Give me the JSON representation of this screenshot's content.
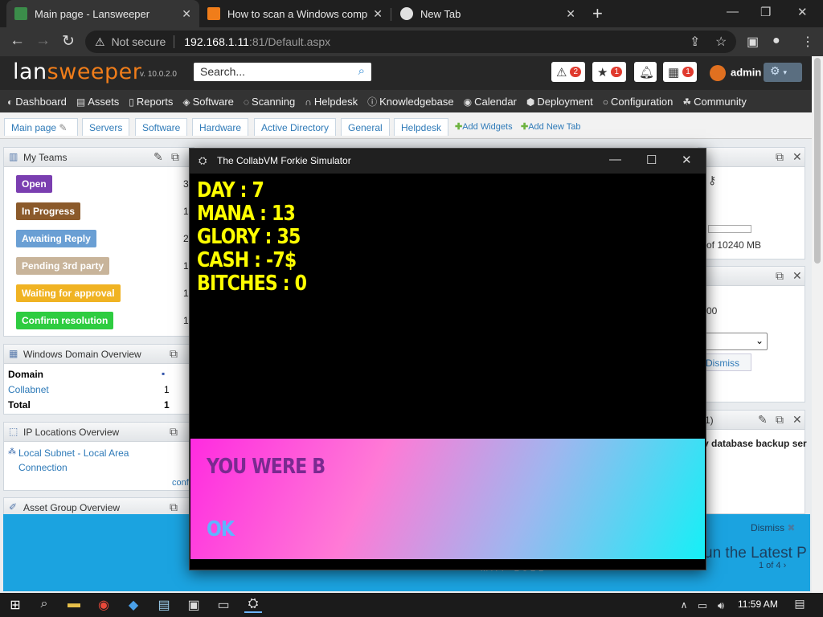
{
  "browser": {
    "tabs": [
      {
        "title": "Main page - Lansweeper"
      },
      {
        "title": "How to scan a Windows compute"
      },
      {
        "title": "New Tab"
      }
    ],
    "new_tab_glyph": "+",
    "omnibox": {
      "security": "Not secure",
      "host": "192.168.1.11",
      "path": ":81/Default.aspx"
    }
  },
  "lansweeper": {
    "logo_part1": "lan",
    "logo_part2": "sweeper",
    "version": "v. 10.0.2.0",
    "search_placeholder": "Search...",
    "badges": {
      "alerts": "2",
      "favorites": "1",
      "calendar": "1"
    },
    "user": "admin",
    "menu": [
      "Dashboard",
      "Assets",
      "Reports",
      "Software",
      "Scanning",
      "Helpdesk",
      "Knowledgebase",
      "Calendar",
      "Deployment",
      "Configuration",
      "Community"
    ],
    "subtabs": [
      "Main page",
      "Servers",
      "Software",
      "Hardware",
      "Active Directory",
      "General",
      "Helpdesk"
    ],
    "add_widgets": "Add Widgets",
    "add_new_tab": "Add New Tab"
  },
  "my_teams": {
    "title": "My Teams",
    "statuses": [
      {
        "label": "Open",
        "count": "3",
        "color": "#7a3eb0"
      },
      {
        "label": "In Progress",
        "count": "1",
        "color": "#8b5a2b"
      },
      {
        "label": "Awaiting Reply",
        "count": "2",
        "color": "#6a9fd4"
      },
      {
        "label": "Pending 3rd party",
        "count": "1",
        "color": "#c8b49a"
      },
      {
        "label": "Waiting for approval",
        "count": "1",
        "color": "#f0b323"
      },
      {
        "label": "Confirm resolution",
        "count": "1",
        "color": "#2ecc40"
      }
    ]
  },
  "domain_overview": {
    "title": "Windows Domain Overview",
    "header": "Domain",
    "rows": [
      {
        "name": "Collabnet",
        "count": "1"
      }
    ],
    "total_label": "Total",
    "total_count": "1"
  },
  "ip_locations": {
    "title": "IP Locations Overview",
    "entry_line1": "Local Subnet - Local Area",
    "entry_line2": "Connection",
    "config_link": "confi"
  },
  "asset_group": {
    "title": "Asset Group Overview"
  },
  "right_panels": {
    "disk_text": "of 10240 MB",
    "value_00": "00",
    "dismiss": "Dismiss",
    "count_1": "1)",
    "backup_text": "v database backup ser",
    "banner_dismiss": "Dismiss",
    "banner_text": "un the Latest P",
    "banner_pager": "1 of 4",
    "banner_date": "MAY 2022"
  },
  "game": {
    "title": "The CollabVM Forkie Simulator",
    "stats": [
      "DAY : 7",
      "MANA : 13",
      "GLORY : 35",
      "CASH : -7$",
      "BITCHES : 0"
    ],
    "message": "YOU WERE B",
    "ok": "OK"
  },
  "taskbar": {
    "time": "11:59 AM"
  }
}
